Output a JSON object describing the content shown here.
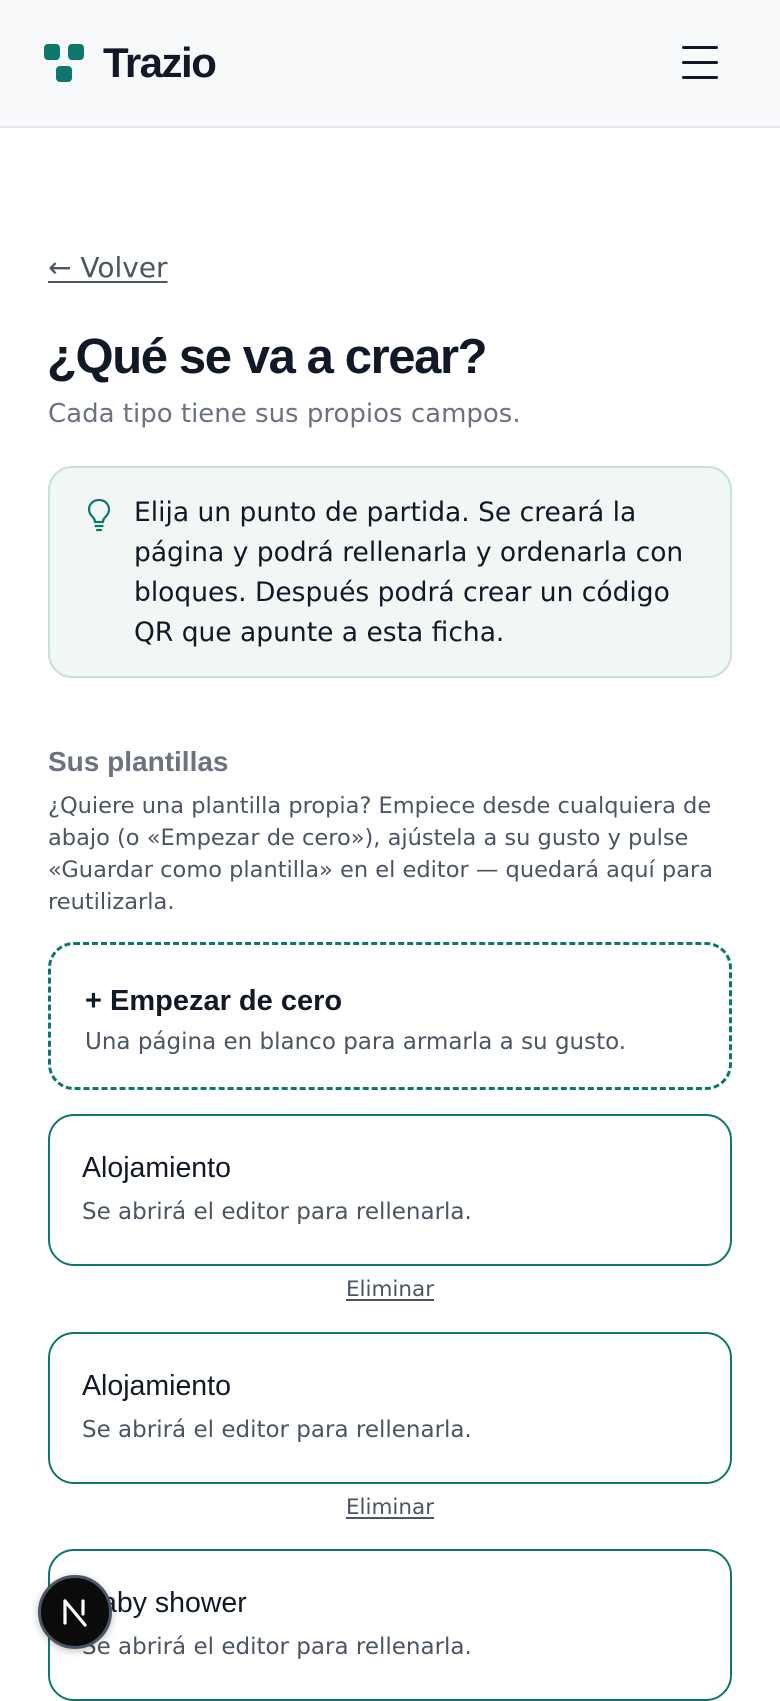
{
  "header": {
    "brand": "Trazio",
    "logo_icon": "trazio-logo-icon",
    "menu_icon": "hamburger-menu-icon"
  },
  "back_link": "← Volver",
  "title": "¿Qué se va a crear?",
  "subtitle": "Cada tipo tiene sus propios campos.",
  "info": {
    "icon": "lightbulb-icon",
    "text": "Elija un punto de partida. Se creará la página y podrá rellenarla y ordenarla con bloques. Después podrá crear un código QR que apunte a esta ficha."
  },
  "templates_section": {
    "title": "Sus plantillas",
    "description": "¿Quiere una plantilla propia? Empiece desde cualquiera de abajo (o «Empezar de cero»), ajústela a su gusto y pulse «Guardar como plantilla» en el editor — quedará aquí para reutilizarla."
  },
  "start_blank": {
    "title": "+ Empezar de cero",
    "description": "Una página en blanco para armarla a su gusto."
  },
  "templates": [
    {
      "title": "Alojamiento",
      "description": "Se abrirá el editor para rellenarla.",
      "delete_label": "Eliminar"
    },
    {
      "title": "Alojamiento",
      "description": "Se abrirá el editor para rellenarla.",
      "delete_label": "Eliminar"
    },
    {
      "title": "Baby shower",
      "description": "Se abrirá el editor para rellenarla."
    }
  ],
  "dev_badge": {
    "icon": "nextjs-n-icon"
  },
  "colors": {
    "accent": "#0f766e",
    "info_bg": "#f0f7f5",
    "info_border": "#c7e0da",
    "topbar_bg": "#f8f9fa",
    "text_primary": "#111827",
    "text_muted": "#6b7280"
  }
}
